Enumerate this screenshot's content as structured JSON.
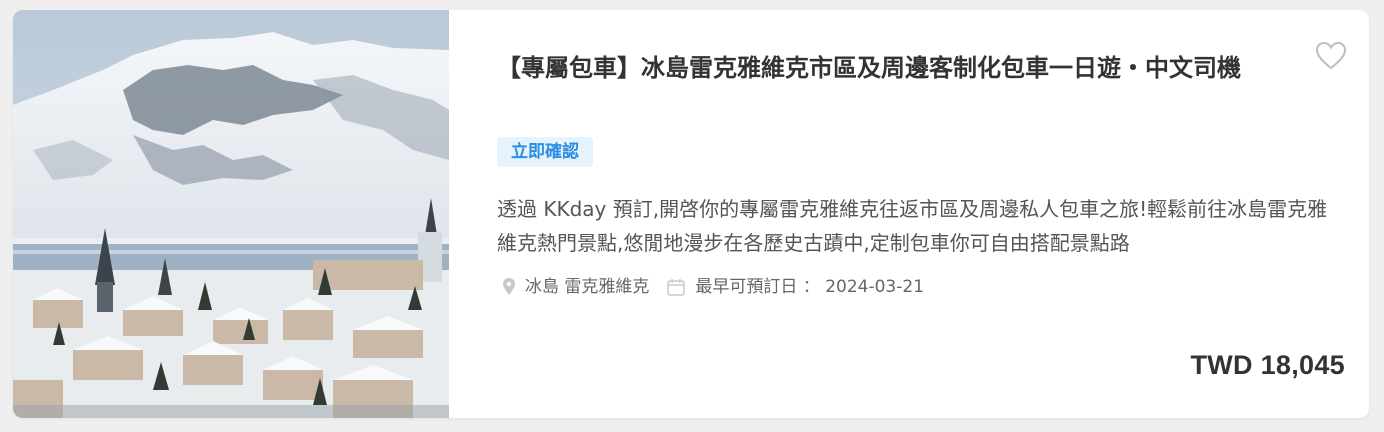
{
  "product": {
    "title": "【專屬包車】冰島雷克雅維克市區及周邊客制化包車一日遊・中文司機",
    "badge": "立即確認",
    "description": "透過 KKday 預訂,開啓你的專屬雷克雅維克往返市區及周邊私人包車之旅!輕鬆前往冰島雷克雅維克熱門景點,悠閒地漫步在各歷史古蹟中,定制包車你可自由搭配景點路",
    "location": "冰島 雷克雅維克",
    "earliest_date": "最早可預訂日 ： 2024-03-21",
    "price": "TWD 18,045"
  },
  "icons": {
    "favorite": "heart-outline-icon",
    "location": "map-pin-icon",
    "date": "calendar-icon"
  },
  "colors": {
    "badge_text": "#2b8de3",
    "badge_bg": "#e6f3fd",
    "title": "#333333"
  }
}
